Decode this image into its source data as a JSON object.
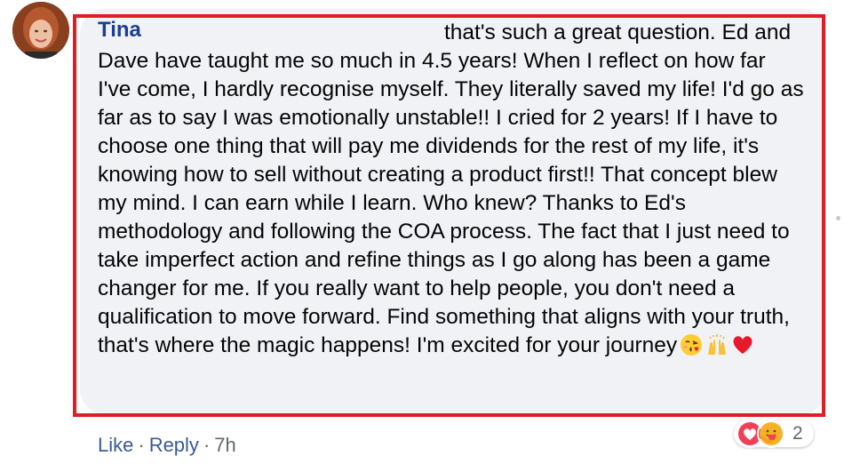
{
  "comment": {
    "author": "Tina",
    "text": "that's such a great question. Ed and Dave have taught me so much in 4.5 years! When I reflect on how far I've come, I hardly recognise myself. They literally saved my life! I'd go as far as to say I was emotionally unstable!! I cried for 2 years! If I have to choose one thing that will pay me dividends for the rest of my life, it's knowing how to sell without creating a product first!! That concept blew my mind. I can earn while I learn. Who knew? Thanks to Ed's methodology and following the COA process. The fact that I just need to take imperfect action and refine things as I go along has been a game changer for me. If you really want to help people, you don't need a qualification to move forward. Find something that aligns with your truth, that's where the magic happens! I'm excited for your",
    "last_word": "journey",
    "emojis": [
      "face-blowing-kiss",
      "raising-hands",
      "red-heart"
    ]
  },
  "actions": {
    "like": "Like",
    "reply": "Reply",
    "separator": "·",
    "time": "7h"
  },
  "reactions": {
    "icons": [
      "love-reaction",
      "care-reaction"
    ],
    "count": "2"
  },
  "colors": {
    "bubble": "#f0f2f5",
    "frame": "#e01d24",
    "author": "#1c3f94",
    "link": "#3b5998"
  }
}
